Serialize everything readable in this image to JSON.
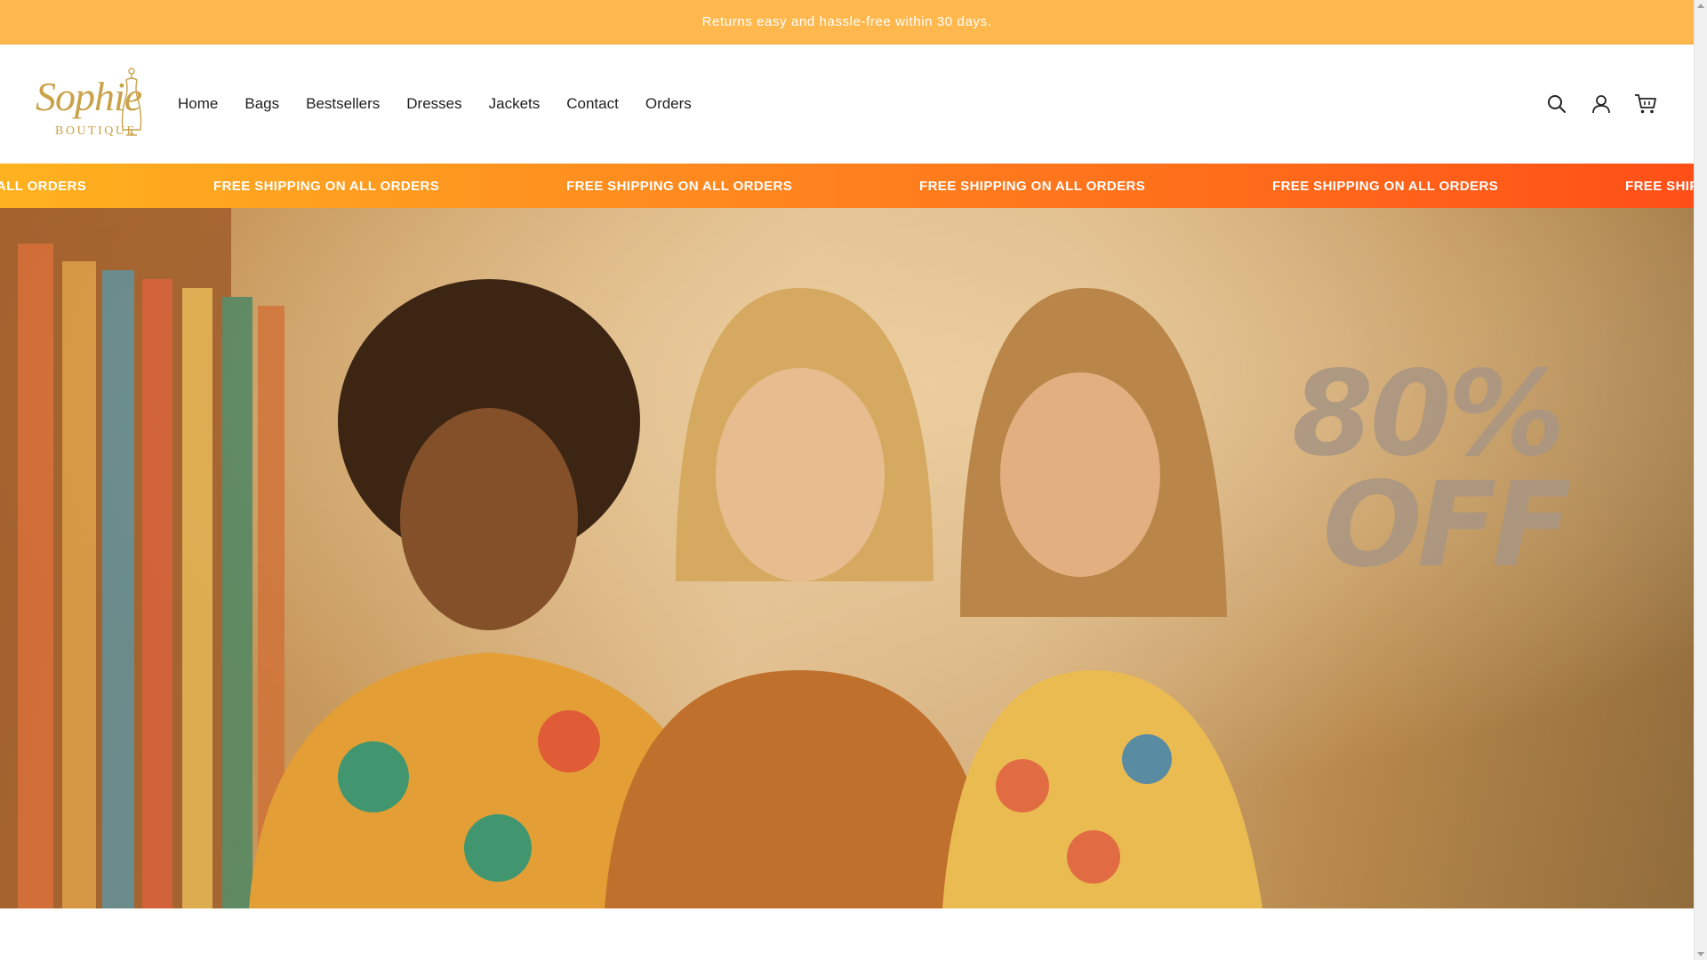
{
  "announcement": {
    "text": "Returns easy and hassle-free within 30 days."
  },
  "brand": {
    "logo_script": "Sophie",
    "logo_sub": "BOUTIQUE",
    "color": "#c9a24a"
  },
  "nav": [
    {
      "label": "Home"
    },
    {
      "label": "Bags"
    },
    {
      "label": "Bestsellers"
    },
    {
      "label": "Dresses"
    },
    {
      "label": "Jackets"
    },
    {
      "label": "Contact"
    },
    {
      "label": "Orders"
    }
  ],
  "header_icons": [
    "search-icon",
    "account-icon",
    "cart-icon"
  ],
  "marquee": {
    "items": [
      "FREE SHIPPING ON ALL ORDERS",
      "FREE SHIPPING ON ALL ORDERS",
      "FREE SHIPPING ON ALL ORDERS",
      "FREE SHIPPING ON ALL ORDERS",
      "FREE SHIPPING ON ALL ORDERS",
      "FREE SHIPPING ON ALL ORDERS"
    ],
    "colors": [
      "#ffb21f",
      "#ff4f18"
    ]
  },
  "hero": {
    "offer_line1": "80%",
    "offer_line2": "OFF"
  },
  "colors": {
    "announcement_bg": "#ffb84d",
    "accent": "#ff6a1a"
  }
}
